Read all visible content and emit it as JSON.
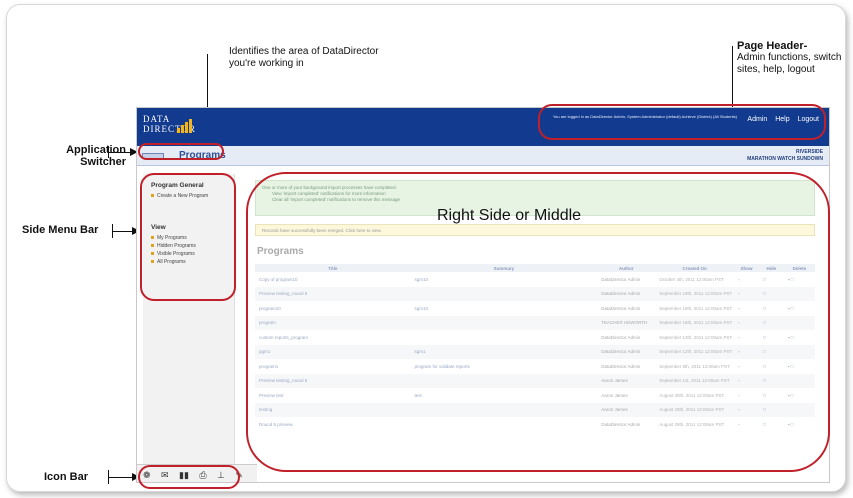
{
  "annotations": {
    "area_note": "Identifies the area of DataDirector you're working in",
    "page_header_title": "Page Header-",
    "page_header_desc": "Admin functions, switch sites, help, logout",
    "app_switcher": "Application Switcher",
    "side_menu": "Side Menu Bar",
    "icon_bar": "Icon Bar",
    "main_area": "Right Side or Middle"
  },
  "app": {
    "logo_line1": "DATA",
    "logo_line2": "DIRECTOR",
    "login_msg": "You are logged in as DataDirector Admin, System Administrator (default) Achieve (District) (All Students)",
    "links": [
      "Admin",
      "Help",
      "Logout"
    ],
    "section": "Programs",
    "site_name": "RIVERSIDE",
    "site_sub": "MARATHON WATCH SUNDOWN"
  },
  "sidebar": {
    "groups": [
      {
        "title": "Program General",
        "items": [
          "Create a New Program"
        ]
      },
      {
        "title": "View",
        "items": [
          "My Programs",
          "Hidden Programs",
          "Visible Programs",
          "All Programs"
        ]
      }
    ]
  },
  "messages": {
    "green": "One or more of your background import processes have completed.",
    "green_item1": "View 'import completed' notifications for more information",
    "green_item2": "Clear all 'import completed' notifications to remove this message",
    "yellow": "Records have successfully been merged. Click here to view."
  },
  "table": {
    "title": "Programs",
    "headers": [
      "Title",
      "Summary",
      "Author",
      "Created On",
      "Show",
      "Hide",
      "Delete"
    ],
    "rows": [
      [
        "Copy of program10",
        "sgm10",
        "DataDirector Admin",
        "October 4th, 2011 12:00am PST"
      ],
      [
        "Preview testing_round 6",
        "",
        "DataDirector Admin",
        "September 19th, 2011 12:00am PST"
      ],
      [
        "program10",
        "sgm10",
        "DataDirector Admin",
        "September 19th, 2011 12:00am PST"
      ],
      [
        "program",
        "",
        "TEACHER HEWORTH",
        "September 16th, 2011 12:00am PST"
      ],
      [
        "custom reports_program",
        "",
        "DataDirector Admin",
        "September 13th, 2011 12:00am PST"
      ],
      [
        "pgm1",
        "sgm1",
        "DataDirector Admin",
        "September 12th, 2011 12:00am PST"
      ],
      [
        "program1",
        "program for validate reports",
        "DataDirector Admin",
        "September 9th, 2011 12:00am PST"
      ],
      [
        "Preview testing_round 5",
        "",
        "Aaron James",
        "September 1st, 2011 12:00am PST"
      ],
      [
        "Preview test",
        "test",
        "Aaron James",
        "August 30th, 2011 12:00am PST"
      ],
      [
        "testing",
        "",
        "Aaron James",
        "August 29th, 2011 12:00am PST"
      ],
      [
        "Round 5 preview",
        "",
        "DataDirector Admin",
        "August 29th, 2011 12:00am PST"
      ]
    ]
  },
  "iconbar": {
    "icons": [
      "lifebuoy-icon",
      "mail-icon",
      "chart-icon",
      "printer-icon",
      "upload-icon",
      "pencil-icon"
    ]
  }
}
